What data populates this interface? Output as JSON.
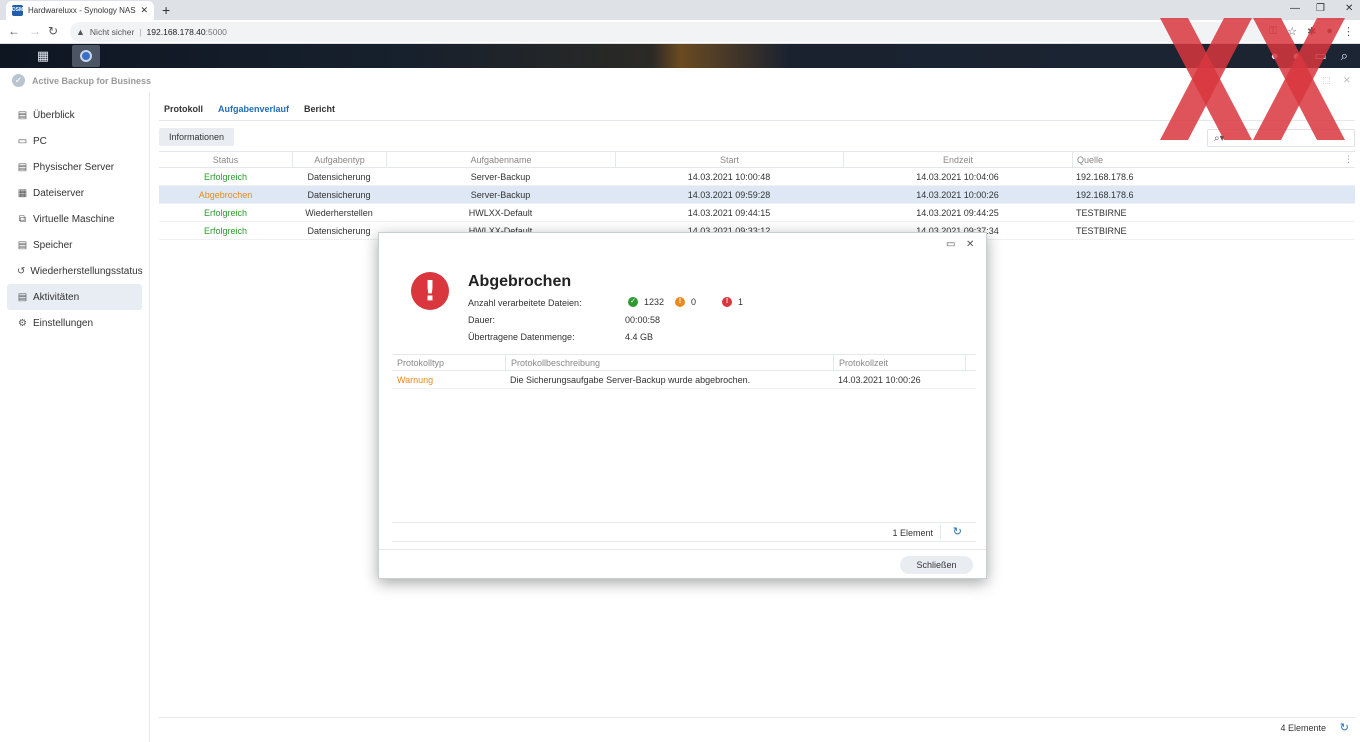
{
  "browser": {
    "tab_title": "Hardwareluxx - Synology NAS",
    "tab_favicon": "DSM",
    "tab_close": "✕",
    "new_tab": "+",
    "insecure_label": "Nicht sicher",
    "url_host": "192.168.178.40",
    "url_port": ":5000",
    "icons": [
      "back-icon",
      "forward-icon",
      "reload-icon",
      "warning-icon",
      "key-icon",
      "star-icon",
      "extension-icon",
      "profile-icon",
      "menu-icon"
    ]
  },
  "app": {
    "title": "Active Backup for Business"
  },
  "sidebar": {
    "items": [
      {
        "label": "Überblick",
        "icon": "overview-icon"
      },
      {
        "label": "PC",
        "icon": "pc-icon"
      },
      {
        "label": "Physischer Server",
        "icon": "server-icon"
      },
      {
        "label": "Dateiserver",
        "icon": "fileserver-icon"
      },
      {
        "label": "Virtuelle Maschine",
        "icon": "vm-icon"
      },
      {
        "label": "Speicher",
        "icon": "storage-icon"
      },
      {
        "label": "Wiederherstellungsstatus",
        "icon": "restore-icon"
      },
      {
        "label": "Aktivitäten",
        "icon": "activity-icon"
      },
      {
        "label": "Einstellungen",
        "icon": "settings-icon"
      }
    ],
    "active_index": 7
  },
  "main": {
    "tabs": [
      {
        "label": "Protokoll"
      },
      {
        "label": "Aufgabenverlauf"
      },
      {
        "label": "Bericht"
      }
    ],
    "active_tab": 1,
    "info_button": "Informationen",
    "columns": [
      "Status",
      "Aufgabentyp",
      "Aufgabenname",
      "Start",
      "Endzeit",
      "Quelle"
    ],
    "rows": [
      {
        "status": "Erfolgreich",
        "type": "Datensicherung",
        "name": "Server-Backup",
        "start": "14.03.2021 10:00:48",
        "end": "14.03.2021 10:04:06",
        "source": "192.168.178.6"
      },
      {
        "status": "Abgebrochen",
        "type": "Datensicherung",
        "name": "Server-Backup",
        "start": "14.03.2021 09:59:28",
        "end": "14.03.2021 10:00:26",
        "source": "192.168.178.6"
      },
      {
        "status": "Erfolgreich",
        "type": "Wiederherstellen",
        "name": "HWLXX-Default",
        "start": "14.03.2021 09:44:15",
        "end": "14.03.2021 09:44:25",
        "source": "TESTBIRNE"
      },
      {
        "status": "Erfolgreich",
        "type": "Datensicherung",
        "name": "HWLXX-Default",
        "start": "14.03.2021 09:33:12",
        "end": "14.03.2021 09:37:34",
        "source": "TESTBIRNE"
      }
    ],
    "selected_row": 1,
    "footer_count": "4 Elemente"
  },
  "dialog": {
    "title": "Abgebrochen",
    "files_label": "Anzahl verarbeitete Dateien:",
    "files_success": "1232",
    "files_warning": "0",
    "files_error": "1",
    "duration_label": "Dauer:",
    "duration_value": "00:00:58",
    "data_label": "Übertragene Datenmenge:",
    "data_value": "4.4 GB",
    "log_columns": [
      "Protokolltyp",
      "Protokollbeschreibung",
      "Protokollzeit"
    ],
    "log_rows": [
      {
        "type": "Warnung",
        "description": "Die Sicherungsaufgabe Server-Backup wurde abgebrochen.",
        "time": "14.03.2021 10:00:26"
      }
    ],
    "log_count": "1 Element",
    "close_button": "Schließen"
  },
  "colors": {
    "success": "#2f9a2f",
    "warning": "#e98a1c",
    "error": "#d9363e",
    "accent": "#1f6fb5",
    "selected_row": "#dde8f4",
    "watermark": "#d9363e"
  }
}
